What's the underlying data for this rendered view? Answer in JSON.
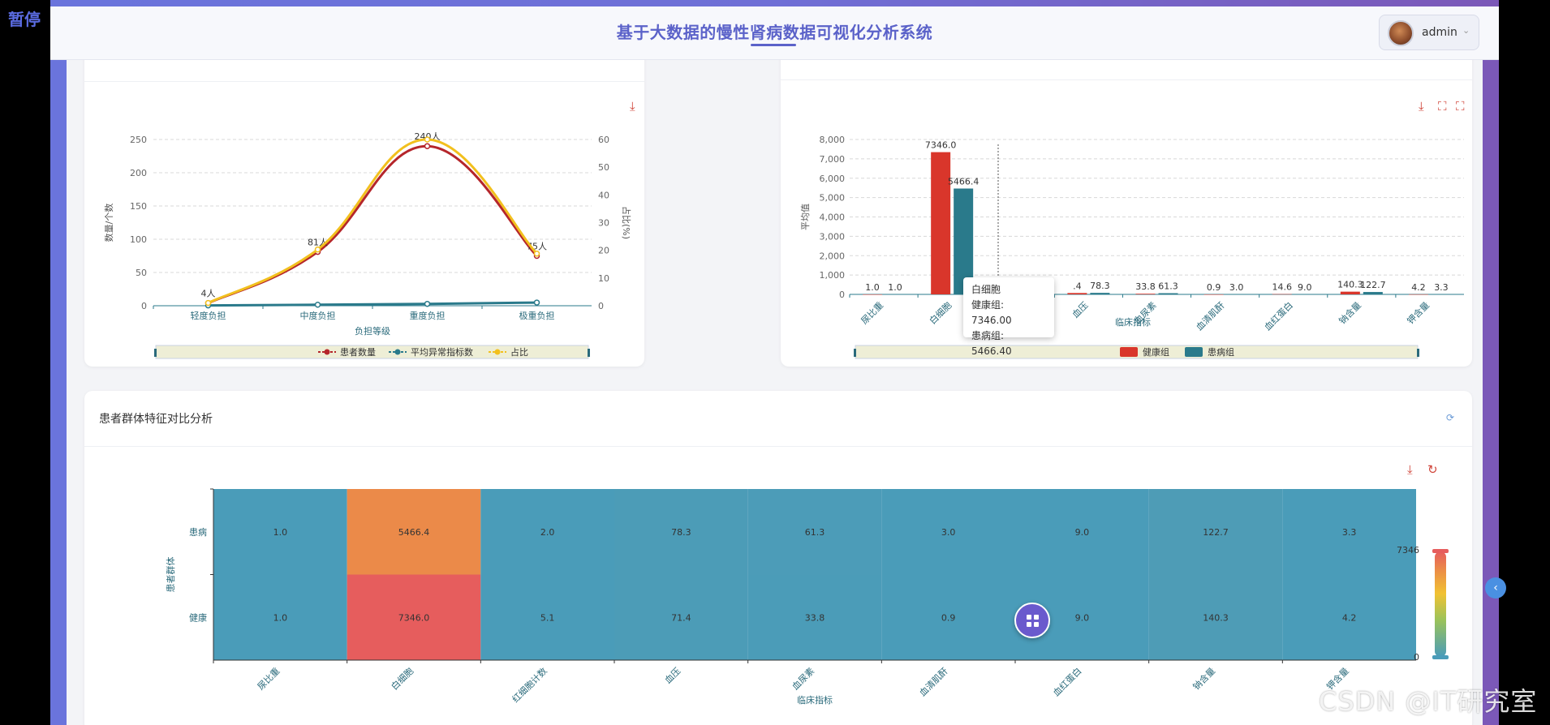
{
  "overlay": {
    "pause_label": "暂停",
    "watermark": "CSDN @IT研究室"
  },
  "header": {
    "title": "基于大数据的慢性肾病数据可视化分析系统",
    "user": "admin",
    "user_chevron": "⌄"
  },
  "tooltip": {
    "title": "白细胞",
    "line1": "健康组: 7346.00",
    "line2": "患病组: 5466.40"
  },
  "card3": {
    "title": "患者群体特征对比分析"
  },
  "colors": {
    "accent": "#5b62c9",
    "red": "#d9362b",
    "teal": "#2a7a8b",
    "yellow": "#f2c01e",
    "darkred": "#b5262b",
    "heat_low": "#4a9cb9",
    "heat_mid": "#ec9245",
    "heat_high": "#e65d5d"
  },
  "chart_data": [
    {
      "type": "line",
      "categories": [
        "轻度负担",
        "中度负担",
        "重度负担",
        "极重负担"
      ],
      "xlabel": "负担等级",
      "ylabel": "数量/个数",
      "y2label": "占比(%)",
      "ylim": [
        0,
        250
      ],
      "y2lim": [
        0,
        60
      ],
      "yticks": [
        0,
        50,
        100,
        150,
        200,
        250
      ],
      "y2ticks": [
        0,
        10,
        20,
        30,
        40,
        50,
        60
      ],
      "series": [
        {
          "name": "患者数量",
          "values": [
            4,
            81,
            240,
            75
          ],
          "labels": [
            "4人",
            "81人",
            "240人",
            "75人"
          ],
          "color": "#b5262b",
          "axis": "left"
        },
        {
          "name": "平均异常指标数",
          "values": [
            0.5,
            1.5,
            2.8,
            4.8
          ],
          "color": "#2a7a8b",
          "axis": "left"
        },
        {
          "name": "占比",
          "values": [
            1.0,
            20.3,
            60.0,
            18.8
          ],
          "color": "#f2c01e",
          "axis": "right"
        }
      ],
      "grid": true,
      "legend": "bottom"
    },
    {
      "type": "bar",
      "categories": [
        "尿比重",
        "白细胞",
        "红细胞计数",
        "血压",
        "血尿素",
        "血清肌酐",
        "血红蛋白",
        "钠含量",
        "钾含量"
      ],
      "visible_tick_labels": [
        "尿比重",
        "白细胞",
        "",
        "血压",
        "血尿素",
        "血清肌酐",
        "血红蛋白",
        "钠含量",
        "钾含量"
      ],
      "xlabel": "临床指标",
      "ylabel": "平均值",
      "ylim": [
        0,
        8000
      ],
      "yticks": [
        "0",
        "1,000",
        "2,000",
        "3,000",
        "4,000",
        "5,000",
        "6,000",
        "7,000",
        "8,000"
      ],
      "series": [
        {
          "name": "健康组",
          "values": [
            1.0,
            7346.0,
            5.1,
            71.4,
            33.8,
            0.9,
            14.6,
            140.3,
            4.2
          ],
          "labels": [
            "1.0",
            "7346.0",
            "",
            ".4",
            "33.8",
            "0.9",
            "14.6",
            "140.3",
            "4.2"
          ],
          "color": "#d9362b"
        },
        {
          "name": "患病组",
          "values": [
            1.0,
            5466.4,
            2.0,
            78.3,
            61.3,
            3.0,
            9.0,
            122.7,
            3.3
          ],
          "labels": [
            "1.0",
            "5466.4",
            "",
            "78.3",
            "61.3",
            "3.0",
            "9.0",
            "122.7",
            "3.3"
          ],
          "color": "#2a7a8b"
        }
      ],
      "grid": true,
      "legend": "bottom"
    },
    {
      "type": "heatmap",
      "x_categories": [
        "尿比重",
        "白细胞",
        "红细胞计数",
        "血压",
        "血尿素",
        "血清肌酐",
        "血红蛋白",
        "钠含量",
        "钾含量"
      ],
      "y_categories": [
        "患病",
        "健康"
      ],
      "xlabel": "临床指标",
      "ylabel": "患者群体",
      "values": [
        [
          1.0,
          5466.4,
          2.0,
          78.3,
          61.3,
          3.0,
          9.0,
          122.7,
          3.3
        ],
        [
          1.0,
          7346.0,
          5.1,
          71.4,
          33.8,
          0.9,
          14.6,
          140.3,
          4.2
        ]
      ],
      "labels": [
        [
          "1.0",
          "5466.4",
          "2.0",
          "78.3",
          "61.3",
          "3.0",
          "9.0",
          "122.7",
          "3.3"
        ],
        [
          "1.0",
          "7346.0",
          "5.1",
          "71.4",
          "33.8",
          "0.9",
          "9.0",
          "140.3",
          "4.2"
        ]
      ],
      "range": [
        0,
        7346
      ],
      "range_labels": [
        "7346",
        "0"
      ]
    }
  ]
}
